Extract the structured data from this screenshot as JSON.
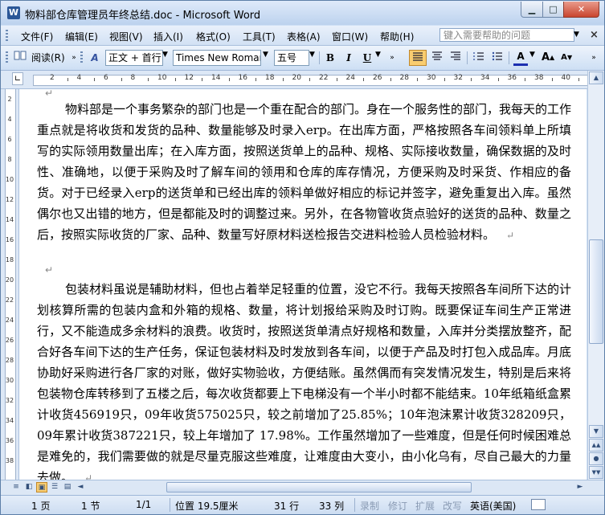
{
  "window": {
    "title": "物料部仓库管理员年终总结.doc - Microsoft Word",
    "app_icon": "W",
    "min_glyph": "▁",
    "max_glyph": "□",
    "close_glyph": "✕"
  },
  "menu": {
    "items": [
      "文件(F)",
      "编辑(E)",
      "视图(V)",
      "插入(I)",
      "格式(O)",
      "工具(T)",
      "表格(A)",
      "窗口(W)",
      "帮助(H)"
    ],
    "help_placeholder": "键入需要帮助的问题",
    "doc_close": "×"
  },
  "toolbar": {
    "reading_label": "阅读(R)",
    "style_value": "正文 + 首行",
    "font_value": "Times New Roman",
    "size_value": "五号",
    "bold": "B",
    "italic": "I",
    "underline": "U",
    "font_color_glyph": "A",
    "grow_font": "A",
    "shrink_font": "A",
    "style_icon_glyph": "A"
  },
  "ruler": {
    "labels": [
      "2",
      "4",
      "6",
      "8",
      "10",
      "12",
      "14",
      "16",
      "18",
      "20",
      "22",
      "24",
      "26",
      "28",
      "30",
      "32",
      "34",
      "36",
      "38",
      "40"
    ]
  },
  "vruler": {
    "labels": [
      "2",
      "4",
      "6",
      "8",
      "10",
      "12",
      "14",
      "16",
      "18",
      "20",
      "22",
      "24",
      "26",
      "28",
      "30",
      "32",
      "34",
      "36",
      "38"
    ]
  },
  "document": {
    "paragraph1": "物料部是一个事务繁杂的部门也是一个重在配合的部门。身在一个服务性的部门，我每天的工作重点就是将收货和发货的品种、数量能够及时录入erp。在出库方面，严格按照各车间领料单上所填写的实际领用数量出库；在入库方面，按照送货单上的品种、规格、实际接收数量，确保数据的及时性、准确地，以便于采购及时了解车间的领用和仓库的库存情况，方便采购及时采货、作相应的备货。对于已经录入erp的送货单和已经出库的领料单做好相应的标记并签字，避免重复出入库。虽然偶尔也又出错的地方，但是都能及时的调整过来。另外，在各物管收货点验好的送货的品种、数量之后，按照实际收货的厂家、品种、数量写好原材料送检报告交进料检验人员检验材料。",
    "paragraph2": "包装材料虽说是辅助材料，但也占着举足轻重的位置，没它不行。我每天按照各车间所下达的计划核算所需的包装内盒和外箱的规格、数量，将计划报给采购及时订购。既要保证车间生产正常进行，又不能造成多余材料的浪费。收货时，按照送货单清点好规格和数量，入库并分类摆放整齐，配合好各车间下达的生产任务，保证包装材料及时发放到各车间，以便于产品及时打包入成品库。月底协助好采购进行各厂家的对账，做好实物验收，方便结账。虽然偶而有突发情况发生，特别是后来将包装物仓库转移到了五楼之后，每次收货都要上下电梯没有一个半小时都不能结束。10年纸箱纸盒累计收货456919只，09年收货575025只，较之前增加了25.85%；10年泡沫累计收货328209只，09年累计收货387221只，较上年增加了 17.98%。工作虽然增加了一些难度，但是任何时候困难总是难免的，我们需要做的就是尽量克服这些难度，让难度由大变小，由小化乌有，尽自己最大的力量去做。",
    "para_mark": "↵"
  },
  "statusbar": {
    "page": "1 页",
    "section": "1 节",
    "pages": "1/1",
    "position": "位置 19.5厘米",
    "line": "31 行",
    "column": "33 列",
    "rec": "录制",
    "trk": "修订",
    "ext": "扩展",
    "ovr": "改写",
    "language": "英语(美国)"
  },
  "scroll": {
    "up": "▲",
    "down": "▼",
    "prev_page": "▲▲",
    "next_page": "▼▼",
    "browse": "●",
    "left": "◄",
    "right": "►"
  },
  "views": {
    "normal": "≡",
    "web": "◧",
    "print": "▣",
    "outline": "☰",
    "reading": "▤"
  }
}
